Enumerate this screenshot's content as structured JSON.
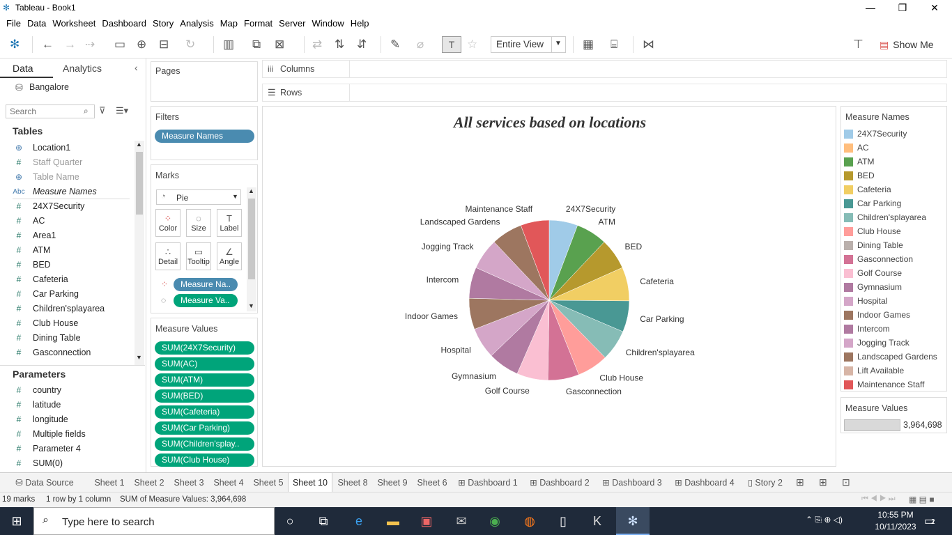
{
  "window": {
    "title": "Tableau - Book1"
  },
  "menu": [
    "File",
    "Data",
    "Worksheet",
    "Dashboard",
    "Story",
    "Analysis",
    "Map",
    "Format",
    "Server",
    "Window",
    "Help"
  ],
  "toolbar": {
    "view_mode": "Entire View",
    "show_me": "Show Me"
  },
  "left": {
    "tab_data": "Data",
    "tab_analytics": "Analytics",
    "datasource": "Bangalore",
    "search_placeholder": "Search",
    "tables_header": "Tables",
    "fields": [
      {
        "name": "Location1",
        "type": "geo",
        "dim": false
      },
      {
        "name": "Staff Quarter",
        "type": "num",
        "dim": true
      },
      {
        "name": "Table Name",
        "type": "geo",
        "dim": true
      },
      {
        "name": "Measure Names",
        "type": "abc",
        "dim": false,
        "italic": true
      },
      {
        "name": "24X7Security",
        "type": "num",
        "dim": false
      },
      {
        "name": "AC",
        "type": "num",
        "dim": false
      },
      {
        "name": "Area1",
        "type": "num",
        "dim": false
      },
      {
        "name": "ATM",
        "type": "num",
        "dim": false
      },
      {
        "name": "BED",
        "type": "num",
        "dim": false
      },
      {
        "name": "Cafeteria",
        "type": "num",
        "dim": false
      },
      {
        "name": "Car Parking",
        "type": "num",
        "dim": false
      },
      {
        "name": "Children'splayarea",
        "type": "num",
        "dim": false
      },
      {
        "name": "Club House",
        "type": "num",
        "dim": false
      },
      {
        "name": "Dining Table",
        "type": "num",
        "dim": false
      },
      {
        "name": "Gasconnection",
        "type": "num",
        "dim": false
      }
    ],
    "parameters_header": "Parameters",
    "parameters": [
      "country",
      "latitude",
      "longitude",
      "Multiple fields",
      "Parameter 4",
      "SUM(0)"
    ]
  },
  "cards": {
    "pages": "Pages",
    "filters": "Filters",
    "filter_pill": "Measure Names",
    "marks": "Marks",
    "mark_type": "Pie",
    "mark_buttons": [
      "Color",
      "Size",
      "Label",
      "Detail",
      "Tooltip",
      "Angle"
    ],
    "mark_pills": [
      "Measure Na..",
      "Measure Va.."
    ],
    "measure_values_title": "Measure Values",
    "measure_values": [
      "SUM(24X7Security)",
      "SUM(AC)",
      "SUM(ATM)",
      "SUM(BED)",
      "SUM(Cafeteria)",
      "SUM(Car Parking)",
      "SUM(Children'splay..",
      "SUM(Club House)"
    ]
  },
  "shelves": {
    "columns": "Columns",
    "rows": "Rows"
  },
  "chart_data": {
    "type": "pie",
    "title": "All services based on locations",
    "categories": [
      "24X7Security",
      "ATM",
      "BED",
      "Cafeteria",
      "Car Parking",
      "Children'splayarea",
      "Club House",
      "Gasconnection",
      "Golf Course",
      "Gymnasium",
      "Hospital",
      "Indoor Games",
      "Intercom",
      "Jogging Track",
      "Landscaped Gardens",
      "Maintenance Staff"
    ],
    "values": [
      5.5,
      6,
      6,
      6.5,
      6,
      6,
      6,
      6,
      6,
      6,
      6,
      6,
      6,
      6,
      6,
      5.5
    ],
    "colors": [
      "#a0cbe8",
      "#ffbe7d",
      "#59a14f",
      "#b6992d",
      "#f1ce63",
      "#499894",
      "#86bcb6",
      "#ff9d9a",
      "#bab0ac",
      "#d37295",
      "#fabfd2",
      "#b07aa1",
      "#d4a6c8",
      "#9d7660",
      "#d4a6c8",
      "#9d7660",
      "#d7b5a6",
      "#e15759"
    ],
    "slice_colors": [
      "#a0cbe8",
      "#ffbe7d",
      "#59a14f",
      "#b6992d",
      "#f1ce63",
      "#499894",
      "#86bcb6",
      "#ff9d9a",
      "#bab0ac",
      "#d37295",
      "#fabfd2",
      "#b07aa1",
      "#d4a6c8",
      "#9d7660",
      "#b07aa1",
      "#d4a6c8",
      "#9d7660",
      "#d7b5a6",
      "#e15759"
    ]
  },
  "legend": {
    "title": "Measure Names",
    "items": [
      {
        "name": "24X7Security",
        "color": "#a0cbe8"
      },
      {
        "name": "AC",
        "color": "#ffbe7d"
      },
      {
        "name": "ATM",
        "color": "#59a14f"
      },
      {
        "name": "BED",
        "color": "#b6992d"
      },
      {
        "name": "Cafeteria",
        "color": "#f1ce63"
      },
      {
        "name": "Car Parking",
        "color": "#499894"
      },
      {
        "name": "Children'splayarea",
        "color": "#86bcb6"
      },
      {
        "name": "Club House",
        "color": "#ff9d9a"
      },
      {
        "name": "Dining Table",
        "color": "#bab0ac"
      },
      {
        "name": "Gasconnection",
        "color": "#d37295"
      },
      {
        "name": "Golf Course",
        "color": "#fabfd2"
      },
      {
        "name": "Gymnasium",
        "color": "#b07aa1"
      },
      {
        "name": "Hospital",
        "color": "#d4a6c8"
      },
      {
        "name": "Indoor Games",
        "color": "#9d7660"
      },
      {
        "name": "Intercom",
        "color": "#b07aa1"
      },
      {
        "name": "Jogging Track",
        "color": "#d4a6c8"
      },
      {
        "name": "Landscaped Gardens",
        "color": "#9d7660"
      },
      {
        "name": "Lift Available",
        "color": "#d7b5a6"
      },
      {
        "name": "Maintenance Staff",
        "color": "#e15759"
      }
    ],
    "size_title": "Measure Values",
    "size_value": "3,964,698"
  },
  "tabs": [
    "Data Source",
    "Sheet 1",
    "Sheet 2",
    "Sheet 3",
    "Sheet 4",
    "Sheet 5",
    "Sheet 10",
    "Sheet 8",
    "Sheet 9",
    "Sheet 6",
    "Dashboard 1",
    "Dashboard 2",
    "Dashboard 3",
    "Dashboard 4",
    "Story 2"
  ],
  "active_tab": "Sheet 10",
  "status": {
    "marks": "19 marks",
    "rows": "1 row by 1 column",
    "sum": "SUM of Measure Values: 3,964,698"
  },
  "taskbar": {
    "search_placeholder": "Type here to search",
    "time": "10:55 PM",
    "date": "10/11/2023",
    "notif": "2"
  }
}
